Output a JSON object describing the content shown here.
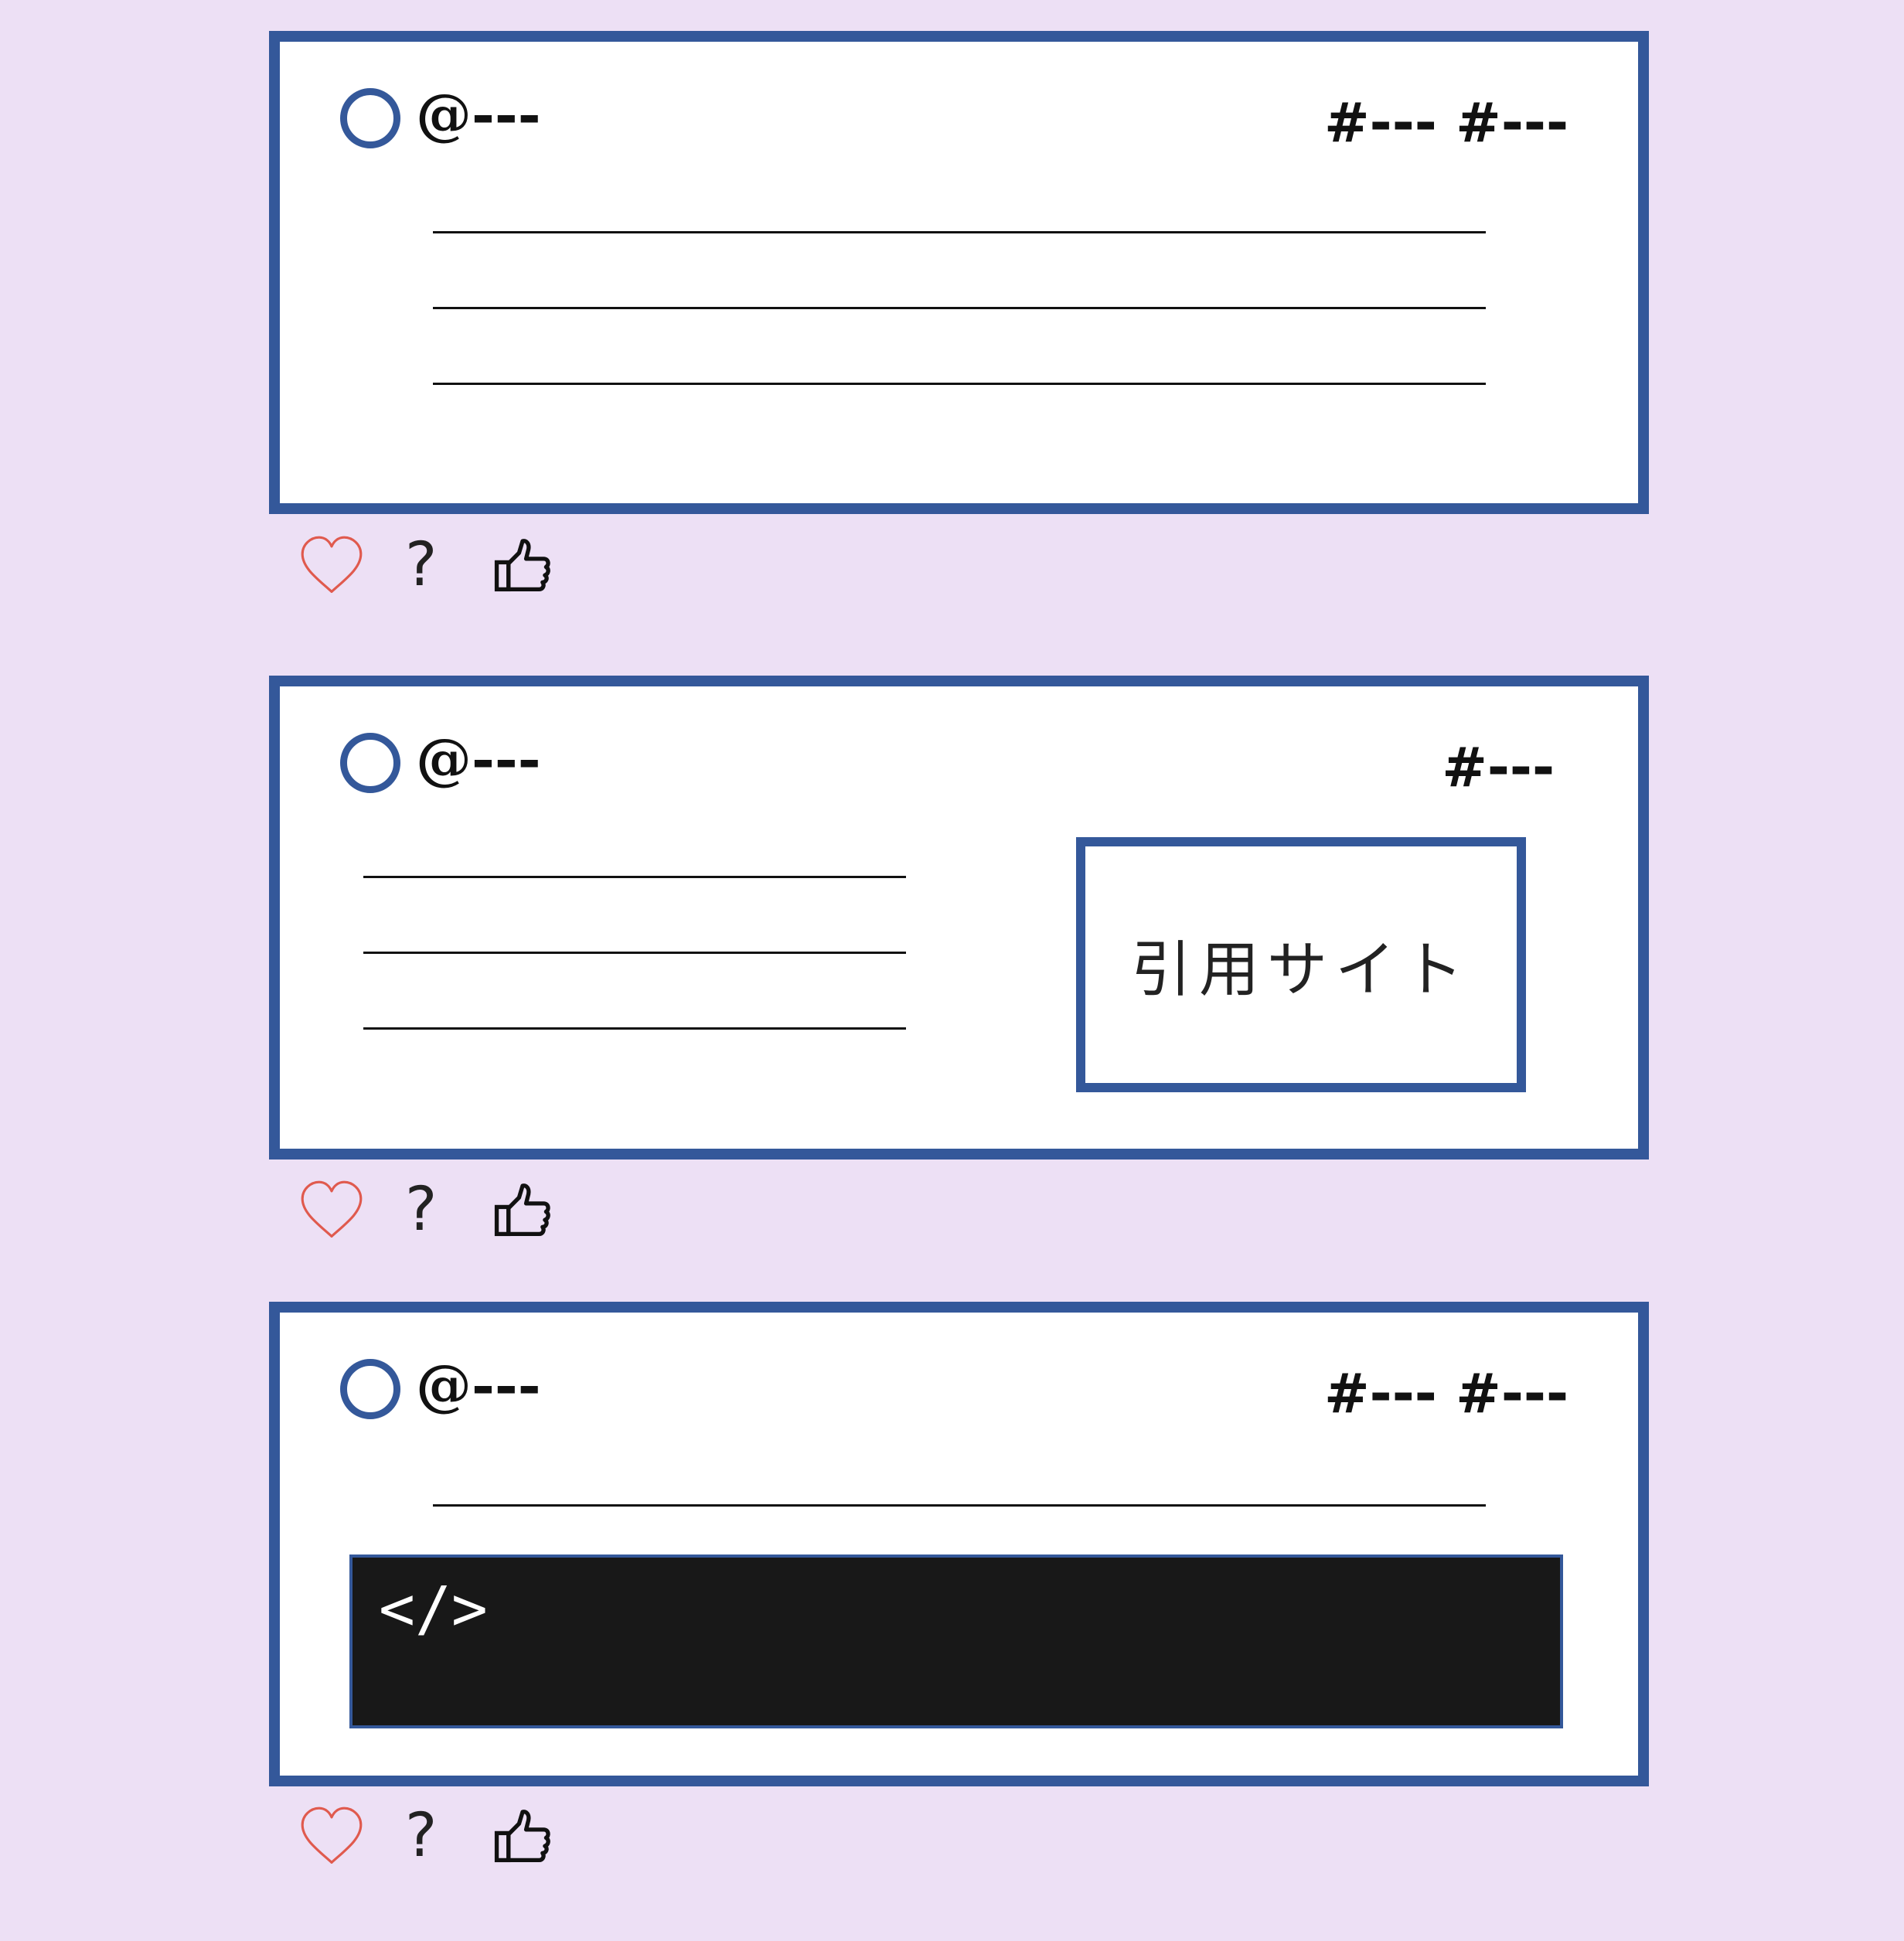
{
  "posts": [
    {
      "handle": "@---",
      "tags": "#--- #---",
      "actions": {
        "question": "?"
      }
    },
    {
      "handle": "@---",
      "tags": "#---",
      "quote": {
        "label": "引用サイト"
      },
      "actions": {
        "question": "?"
      }
    },
    {
      "handle": "@---",
      "tags": "#--- #---",
      "code": {
        "glyph": "</>"
      },
      "actions": {
        "question": "?"
      }
    }
  ],
  "colors": {
    "background": "#ede0f5",
    "card_border": "#34589a",
    "heart": "#e05a4e",
    "code_background": "#181818"
  },
  "icons": [
    "avatar-circle",
    "heart-icon",
    "question-mark",
    "thumbs-up-icon",
    "code-icon"
  ]
}
